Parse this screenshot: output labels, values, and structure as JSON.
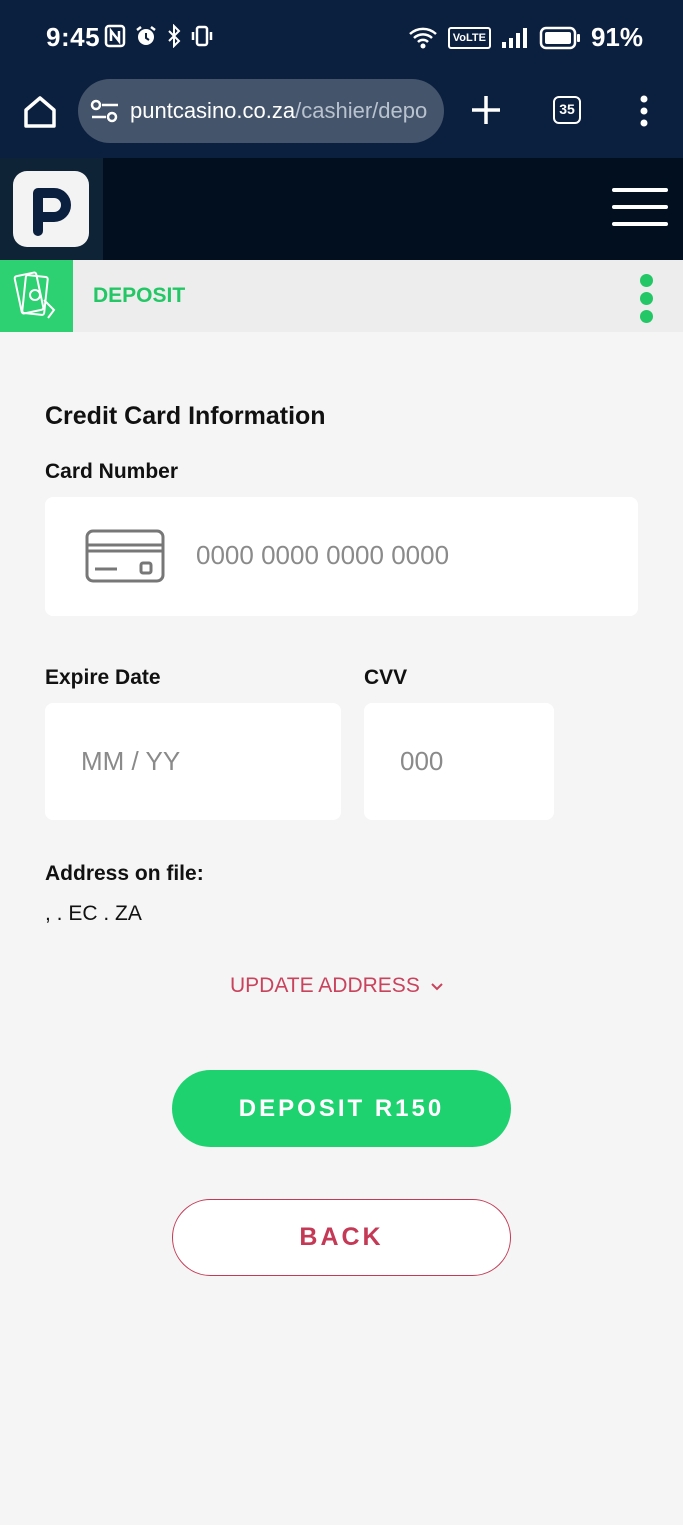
{
  "status_bar": {
    "time": "9:45",
    "battery_pct": "91%",
    "volte": "VoLTE"
  },
  "browser": {
    "url_domain": "puntcasino.co.za",
    "url_path": "/cashier/depo",
    "tab_count": "35"
  },
  "page": {
    "tab_title": "DEPOSIT",
    "section_title": "Credit Card Information",
    "card_number_label": "Card Number",
    "card_number_placeholder": "0000 0000 0000 0000",
    "expire_label": "Expire Date",
    "expire_placeholder": "MM / YY",
    "cvv_label": "CVV",
    "cvv_placeholder": "000",
    "address_label": "Address on file:",
    "address_value": ", . EC . ZA",
    "update_address_label": "UPDATE ADDRESS",
    "deposit_button_label": "DEPOSIT R150",
    "back_button_label": "BACK"
  },
  "colors": {
    "brand_green": "#23c765",
    "accent_red": "#c43955",
    "header_navy": "#0b1f3f"
  },
  "icons": [
    "nfc-icon",
    "alarm-icon",
    "bluetooth-icon",
    "vibrate-icon",
    "wifi-icon",
    "signal-icon",
    "battery-icon",
    "home-icon",
    "site-info-icon",
    "new-tab-icon",
    "tab-switcher-icon",
    "overflow-menu-icon",
    "logo-icon",
    "hamburger-menu-icon",
    "cash-icon",
    "kebab-menu-icon",
    "credit-card-icon",
    "chevron-down-icon"
  ]
}
